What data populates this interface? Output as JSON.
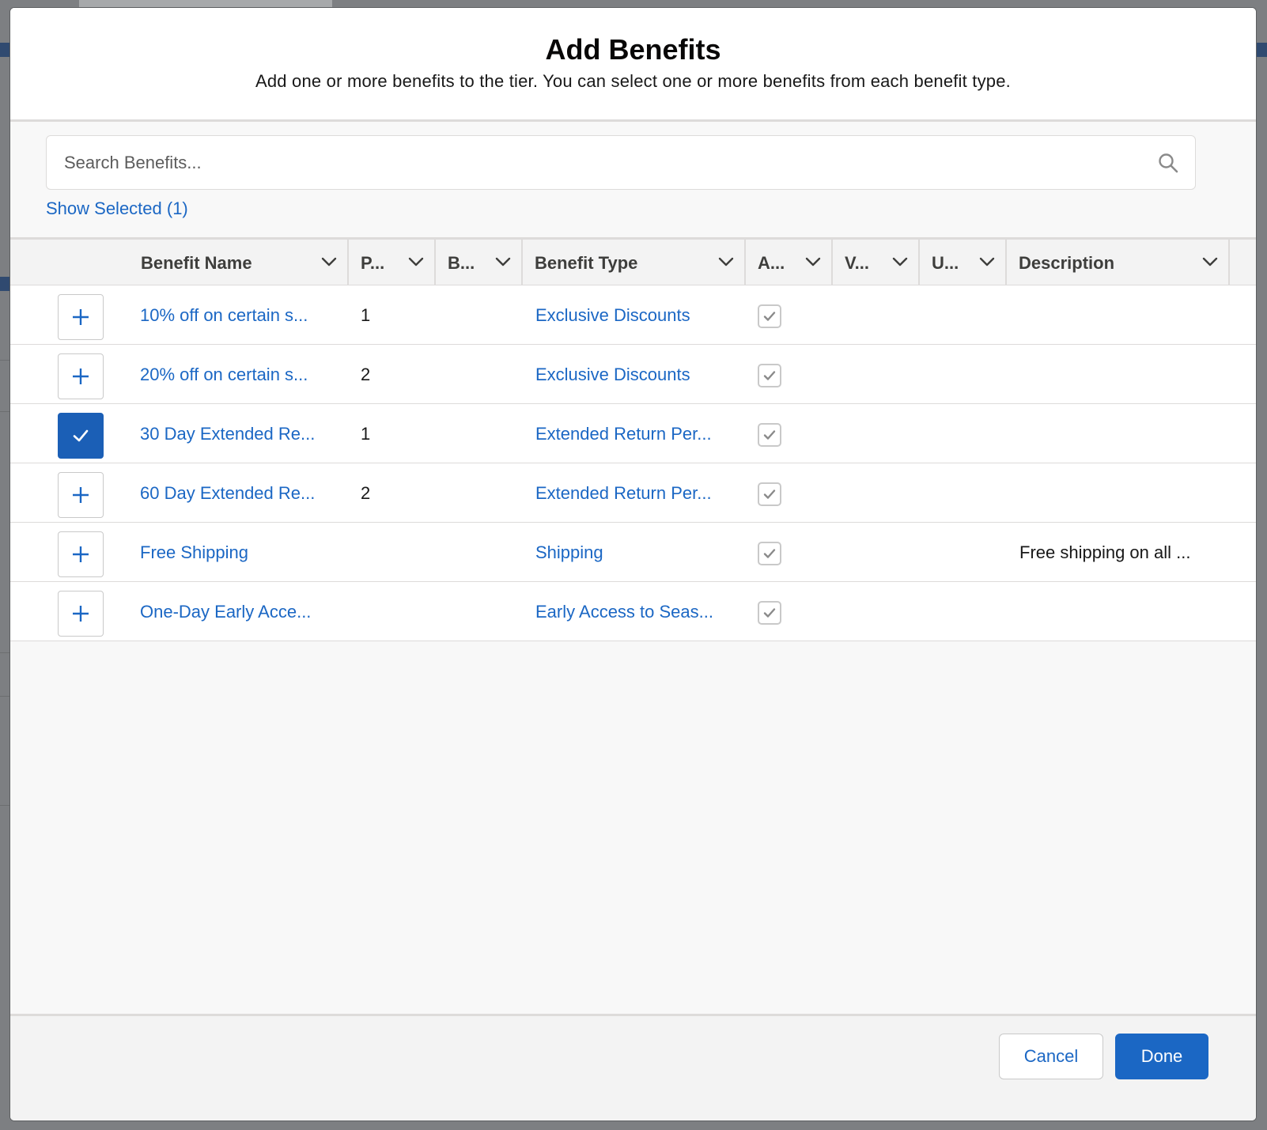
{
  "modal": {
    "title": "Add Benefits",
    "subtitle": "Add one or more benefits to the tier. You can select one or more benefits from each benefit type."
  },
  "search": {
    "placeholder": "Search Benefits..."
  },
  "show_selected": "Show Selected (1)",
  "table": {
    "columns": [
      "Benefit Name",
      "P...",
      "B...",
      "Benefit Type",
      "A...",
      "V...",
      "U...",
      "Description"
    ],
    "rows": [
      {
        "selected": false,
        "name": "10% off on certain s...",
        "p": "1",
        "type": "Exclusive Discounts",
        "active": true,
        "description": ""
      },
      {
        "selected": false,
        "name": "20% off on certain s...",
        "p": "2",
        "type": "Exclusive Discounts",
        "active": true,
        "description": ""
      },
      {
        "selected": true,
        "name": "30 Day Extended Re...",
        "p": "1",
        "type": "Extended Return Per...",
        "active": true,
        "description": ""
      },
      {
        "selected": false,
        "name": "60 Day Extended Re...",
        "p": "2",
        "type": "Extended Return Per...",
        "active": true,
        "description": ""
      },
      {
        "selected": false,
        "name": "Free Shipping",
        "p": "",
        "type": "Shipping",
        "active": true,
        "description": "Free shipping on all ..."
      },
      {
        "selected": false,
        "name": "One-Day Early Acce...",
        "p": "",
        "type": "Early Access to Seas...",
        "active": true,
        "description": ""
      }
    ]
  },
  "footer": {
    "cancel_label": "Cancel",
    "done_label": "Done"
  },
  "colors": {
    "link": "#1b67c4",
    "primary_button": "#1b67c4",
    "selected_toggle": "#1b5fb6"
  },
  "icons": {
    "search": "search-icon",
    "column_menu": "chevron-down-icon",
    "add": "plus-icon",
    "selected": "check-icon",
    "checkbox": "checkbox-checked-icon"
  }
}
